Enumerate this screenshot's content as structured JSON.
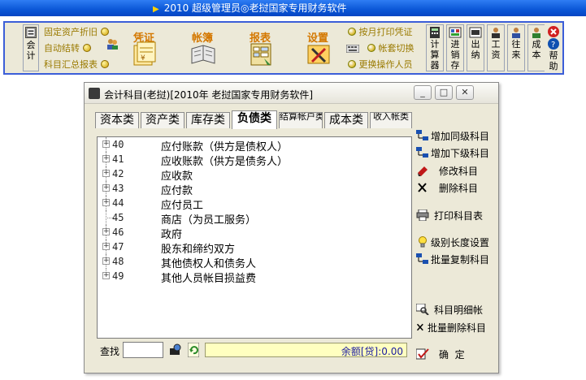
{
  "title": "2010 超级管理员◎老挝国家专用财务软件",
  "toolbar": {
    "calc": "会计",
    "links_left": [
      "固定资产折旧",
      "自动结转",
      "科目汇总报表"
    ],
    "big": [
      "凭证",
      "帐簿",
      "报表",
      "设置"
    ],
    "links_right": [
      "按月打印凭证",
      "帐套切换",
      "更换操作人员"
    ],
    "right_buttons": [
      "计算器",
      "进销存",
      "出纳",
      "工资",
      "往来",
      "成本",
      "帮助"
    ]
  },
  "dialog": {
    "title": "会计科目(老挝)[2010年 老挝国家专用财务软件]",
    "tabs": [
      "资本类",
      "资产类",
      "库存类",
      "负债类",
      "结算帐户类",
      "成本类",
      "收入帐类"
    ],
    "active_tab": "负债类",
    "rows": [
      {
        "code": "40",
        "name": "应付账款（供方是债权人）",
        "expandable": true
      },
      {
        "code": "41",
        "name": "应收账款（供方是债务人）",
        "expandable": true
      },
      {
        "code": "42",
        "name": "应收款",
        "expandable": true
      },
      {
        "code": "43",
        "name": "应付款",
        "expandable": true
      },
      {
        "code": "44",
        "name": "应付员工",
        "expandable": true
      },
      {
        "code": "45",
        "name": "商店（为员工服务）",
        "expandable": false
      },
      {
        "code": "46",
        "name": "政府",
        "expandable": true
      },
      {
        "code": "47",
        "name": "股东和缔约双方",
        "expandable": true
      },
      {
        "code": "48",
        "name": "其他债权人和债务人",
        "expandable": true
      },
      {
        "code": "49",
        "name": "其他人员帐目损益费",
        "expandable": true
      }
    ],
    "actions": [
      "增加同级科目",
      "增加下级科目",
      "修改科目",
      "删除科目",
      "打印科目表",
      "级别长度设置",
      "批量复制科目",
      "科目明细帐",
      "批量删除科目",
      "确  定"
    ],
    "search_label": "查找",
    "search_value": "",
    "balance": "余额[贷]:0.00"
  }
}
